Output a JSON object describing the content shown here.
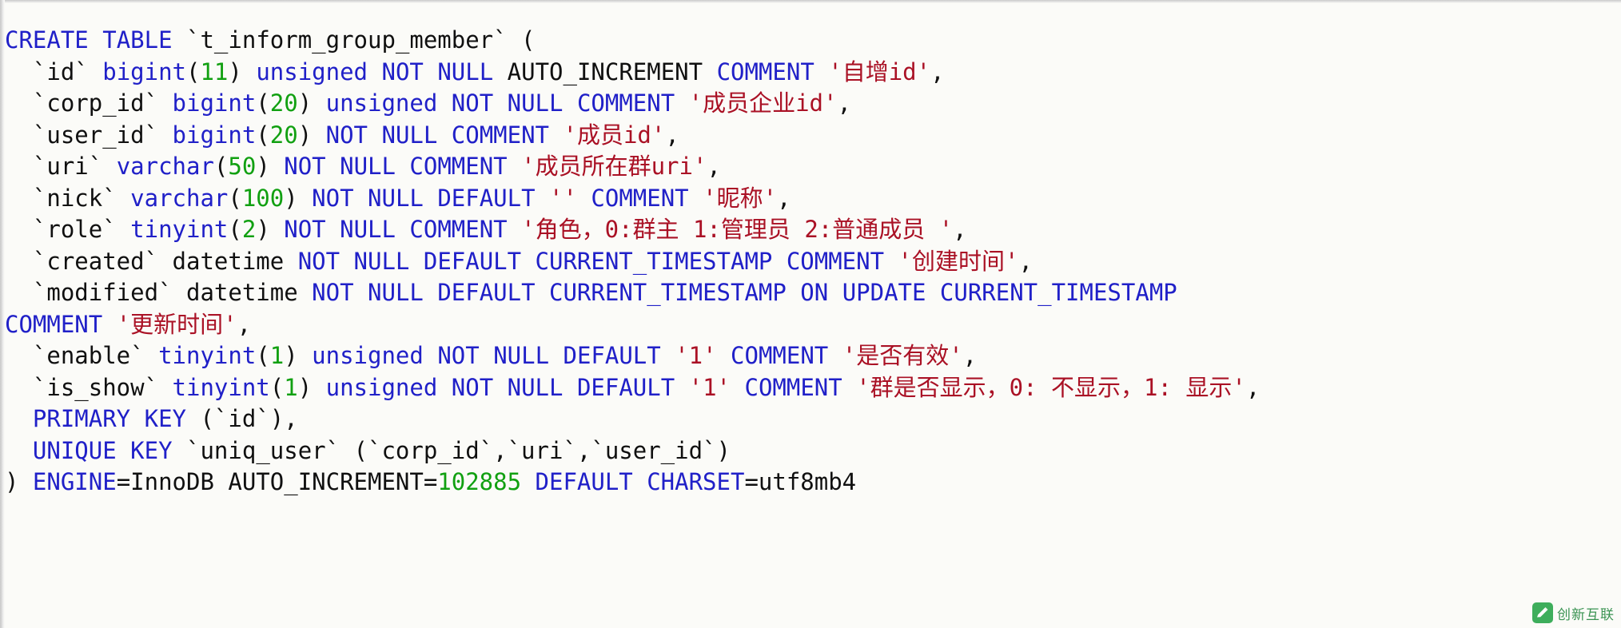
{
  "document": {
    "kind": "sql-create-table",
    "table_name": "t_inform_group_member",
    "engine": "InnoDB",
    "auto_increment": "102885",
    "charset": "utf8mb4",
    "background_color": "#fbfbf8",
    "colors": {
      "keyword": "#2020c8",
      "type": "#2020c8",
      "number": "#11a011",
      "string": "#aa1125",
      "identifier": "#101010"
    }
  },
  "code": {
    "line1": "CREATE TABLE `t_inform_group_member` (",
    "line2": "  `id` bigint(11) unsigned NOT NULL AUTO_INCREMENT COMMENT '自增id',",
    "line3": "  `corp_id` bigint(20) unsigned NOT NULL COMMENT '成员企业id',",
    "line4": "  `user_id` bigint(20) NOT NULL COMMENT '成员id',",
    "line5": "  `uri` varchar(50) NOT NULL COMMENT '成员所在群uri',",
    "line6": "  `nick` varchar(100) NOT NULL DEFAULT '' COMMENT '昵称',",
    "line7": "  `role` tinyint(2) NOT NULL COMMENT '角色，0:群主 1:管理员 2:普通成员 ',",
    "line8": "  `created` datetime NOT NULL DEFAULT CURRENT_TIMESTAMP COMMENT '创建时间',",
    "line9": "  `modified` datetime NOT NULL DEFAULT CURRENT_TIMESTAMP ON UPDATE CURRENT_TIMESTAMP",
    "line10": "COMMENT '更新时间',",
    "line11": "  `enable` tinyint(1) unsigned NOT NULL DEFAULT '1' COMMENT '是否有效',",
    "line12": "  `is_show` tinyint(1) unsigned NOT NULL DEFAULT '1' COMMENT '群是否显示，0: 不显示，1: 显示',",
    "line13": "  PRIMARY KEY (`id`),",
    "line14": "  UNIQUE KEY `uniq_user` (`corp_id`,`uri`,`user_id`)",
    "line15": ") ENGINE=InnoDB AUTO_INCREMENT=102885 DEFAULT CHARSET=utf8mb4"
  },
  "tokens": {
    "l1": [
      {
        "t": "CREATE",
        "c": "kw"
      },
      {
        "t": " ",
        "c": "pl"
      },
      {
        "t": "TABLE",
        "c": "kw"
      },
      {
        "t": " ",
        "c": "pl"
      },
      {
        "t": "`t_inform_group_member`",
        "c": "id"
      },
      {
        "t": " (",
        "c": "id"
      }
    ],
    "l2": [
      {
        "t": "  ",
        "c": "pl"
      },
      {
        "t": "`id`",
        "c": "id"
      },
      {
        "t": " ",
        "c": "pl"
      },
      {
        "t": "bigint",
        "c": "typ"
      },
      {
        "t": "(",
        "c": "id"
      },
      {
        "t": "11",
        "c": "num"
      },
      {
        "t": ")",
        "c": "id"
      },
      {
        "t": " ",
        "c": "pl"
      },
      {
        "t": "unsigned",
        "c": "kw"
      },
      {
        "t": " ",
        "c": "pl"
      },
      {
        "t": "NOT",
        "c": "kw"
      },
      {
        "t": " ",
        "c": "pl"
      },
      {
        "t": "NULL",
        "c": "kw"
      },
      {
        "t": " ",
        "c": "pl"
      },
      {
        "t": "AUTO_INCREMENT",
        "c": "id"
      },
      {
        "t": " ",
        "c": "pl"
      },
      {
        "t": "COMMENT",
        "c": "kw"
      },
      {
        "t": " ",
        "c": "pl"
      },
      {
        "t": "'自增id'",
        "c": "str"
      },
      {
        "t": ",",
        "c": "id"
      }
    ],
    "l3": [
      {
        "t": "  ",
        "c": "pl"
      },
      {
        "t": "`corp_id`",
        "c": "id"
      },
      {
        "t": " ",
        "c": "pl"
      },
      {
        "t": "bigint",
        "c": "typ"
      },
      {
        "t": "(",
        "c": "id"
      },
      {
        "t": "20",
        "c": "num"
      },
      {
        "t": ")",
        "c": "id"
      },
      {
        "t": " ",
        "c": "pl"
      },
      {
        "t": "unsigned",
        "c": "kw"
      },
      {
        "t": " ",
        "c": "pl"
      },
      {
        "t": "NOT",
        "c": "kw"
      },
      {
        "t": " ",
        "c": "pl"
      },
      {
        "t": "NULL",
        "c": "kw"
      },
      {
        "t": " ",
        "c": "pl"
      },
      {
        "t": "COMMENT",
        "c": "kw"
      },
      {
        "t": " ",
        "c": "pl"
      },
      {
        "t": "'成员企业id'",
        "c": "str"
      },
      {
        "t": ",",
        "c": "id"
      }
    ],
    "l4": [
      {
        "t": "  ",
        "c": "pl"
      },
      {
        "t": "`user_id`",
        "c": "id"
      },
      {
        "t": " ",
        "c": "pl"
      },
      {
        "t": "bigint",
        "c": "typ"
      },
      {
        "t": "(",
        "c": "id"
      },
      {
        "t": "20",
        "c": "num"
      },
      {
        "t": ")",
        "c": "id"
      },
      {
        "t": " ",
        "c": "pl"
      },
      {
        "t": "NOT",
        "c": "kw"
      },
      {
        "t": " ",
        "c": "pl"
      },
      {
        "t": "NULL",
        "c": "kw"
      },
      {
        "t": " ",
        "c": "pl"
      },
      {
        "t": "COMMENT",
        "c": "kw"
      },
      {
        "t": " ",
        "c": "pl"
      },
      {
        "t": "'成员id'",
        "c": "str"
      },
      {
        "t": ",",
        "c": "id"
      }
    ],
    "l5": [
      {
        "t": "  ",
        "c": "pl"
      },
      {
        "t": "`uri`",
        "c": "id"
      },
      {
        "t": " ",
        "c": "pl"
      },
      {
        "t": "varchar",
        "c": "typ"
      },
      {
        "t": "(",
        "c": "id"
      },
      {
        "t": "50",
        "c": "num"
      },
      {
        "t": ")",
        "c": "id"
      },
      {
        "t": " ",
        "c": "pl"
      },
      {
        "t": "NOT",
        "c": "kw"
      },
      {
        "t": " ",
        "c": "pl"
      },
      {
        "t": "NULL",
        "c": "kw"
      },
      {
        "t": " ",
        "c": "pl"
      },
      {
        "t": "COMMENT",
        "c": "kw"
      },
      {
        "t": " ",
        "c": "pl"
      },
      {
        "t": "'成员所在群uri'",
        "c": "str"
      },
      {
        "t": ",",
        "c": "id"
      }
    ],
    "l6": [
      {
        "t": "  ",
        "c": "pl"
      },
      {
        "t": "`nick`",
        "c": "id"
      },
      {
        "t": " ",
        "c": "pl"
      },
      {
        "t": "varchar",
        "c": "typ"
      },
      {
        "t": "(",
        "c": "id"
      },
      {
        "t": "100",
        "c": "num"
      },
      {
        "t": ")",
        "c": "id"
      },
      {
        "t": " ",
        "c": "pl"
      },
      {
        "t": "NOT",
        "c": "kw"
      },
      {
        "t": " ",
        "c": "pl"
      },
      {
        "t": "NULL",
        "c": "kw"
      },
      {
        "t": " ",
        "c": "pl"
      },
      {
        "t": "DEFAULT",
        "c": "kw"
      },
      {
        "t": " ",
        "c": "pl"
      },
      {
        "t": "''",
        "c": "str"
      },
      {
        "t": " ",
        "c": "pl"
      },
      {
        "t": "COMMENT",
        "c": "kw"
      },
      {
        "t": " ",
        "c": "pl"
      },
      {
        "t": "'昵称'",
        "c": "str"
      },
      {
        "t": ",",
        "c": "id"
      }
    ],
    "l7": [
      {
        "t": "  ",
        "c": "pl"
      },
      {
        "t": "`role`",
        "c": "id"
      },
      {
        "t": " ",
        "c": "pl"
      },
      {
        "t": "tinyint",
        "c": "typ"
      },
      {
        "t": "(",
        "c": "id"
      },
      {
        "t": "2",
        "c": "num"
      },
      {
        "t": ")",
        "c": "id"
      },
      {
        "t": " ",
        "c": "pl"
      },
      {
        "t": "NOT",
        "c": "kw"
      },
      {
        "t": " ",
        "c": "pl"
      },
      {
        "t": "NULL",
        "c": "kw"
      },
      {
        "t": " ",
        "c": "pl"
      },
      {
        "t": "COMMENT",
        "c": "kw"
      },
      {
        "t": " ",
        "c": "pl"
      },
      {
        "t": "'角色，0:群主 1:管理员 2:普通成员 '",
        "c": "str"
      },
      {
        "t": ",",
        "c": "id"
      }
    ],
    "l8": [
      {
        "t": "  ",
        "c": "pl"
      },
      {
        "t": "`created`",
        "c": "id"
      },
      {
        "t": " ",
        "c": "pl"
      },
      {
        "t": "datetime",
        "c": "id"
      },
      {
        "t": " ",
        "c": "pl"
      },
      {
        "t": "NOT",
        "c": "kw"
      },
      {
        "t": " ",
        "c": "pl"
      },
      {
        "t": "NULL",
        "c": "kw"
      },
      {
        "t": " ",
        "c": "pl"
      },
      {
        "t": "DEFAULT",
        "c": "kw"
      },
      {
        "t": " ",
        "c": "pl"
      },
      {
        "t": "CURRENT_TIMESTAMP",
        "c": "kw"
      },
      {
        "t": " ",
        "c": "pl"
      },
      {
        "t": "COMMENT",
        "c": "kw"
      },
      {
        "t": " ",
        "c": "pl"
      },
      {
        "t": "'创建时间'",
        "c": "str"
      },
      {
        "t": ",",
        "c": "id"
      }
    ],
    "l9": [
      {
        "t": "  ",
        "c": "pl"
      },
      {
        "t": "`modified`",
        "c": "id"
      },
      {
        "t": " ",
        "c": "pl"
      },
      {
        "t": "datetime",
        "c": "id"
      },
      {
        "t": " ",
        "c": "pl"
      },
      {
        "t": "NOT",
        "c": "kw"
      },
      {
        "t": " ",
        "c": "pl"
      },
      {
        "t": "NULL",
        "c": "kw"
      },
      {
        "t": " ",
        "c": "pl"
      },
      {
        "t": "DEFAULT",
        "c": "kw"
      },
      {
        "t": " ",
        "c": "pl"
      },
      {
        "t": "CURRENT_TIMESTAMP",
        "c": "kw"
      },
      {
        "t": " ",
        "c": "pl"
      },
      {
        "t": "ON",
        "c": "kw"
      },
      {
        "t": " ",
        "c": "pl"
      },
      {
        "t": "UPDATE",
        "c": "kw"
      },
      {
        "t": " ",
        "c": "pl"
      },
      {
        "t": "CURRENT_TIMESTAMP",
        "c": "kw"
      }
    ],
    "l10": [
      {
        "t": "COMMENT",
        "c": "kw"
      },
      {
        "t": " ",
        "c": "pl"
      },
      {
        "t": "'更新时间'",
        "c": "str"
      },
      {
        "t": ",",
        "c": "id"
      }
    ],
    "l11": [
      {
        "t": "  ",
        "c": "pl"
      },
      {
        "t": "`enable`",
        "c": "id"
      },
      {
        "t": " ",
        "c": "pl"
      },
      {
        "t": "tinyint",
        "c": "typ"
      },
      {
        "t": "(",
        "c": "id"
      },
      {
        "t": "1",
        "c": "num"
      },
      {
        "t": ")",
        "c": "id"
      },
      {
        "t": " ",
        "c": "pl"
      },
      {
        "t": "unsigned",
        "c": "kw"
      },
      {
        "t": " ",
        "c": "pl"
      },
      {
        "t": "NOT",
        "c": "kw"
      },
      {
        "t": " ",
        "c": "pl"
      },
      {
        "t": "NULL",
        "c": "kw"
      },
      {
        "t": " ",
        "c": "pl"
      },
      {
        "t": "DEFAULT",
        "c": "kw"
      },
      {
        "t": " ",
        "c": "pl"
      },
      {
        "t": "'1'",
        "c": "str"
      },
      {
        "t": " ",
        "c": "pl"
      },
      {
        "t": "COMMENT",
        "c": "kw"
      },
      {
        "t": " ",
        "c": "pl"
      },
      {
        "t": "'是否有效'",
        "c": "str"
      },
      {
        "t": ",",
        "c": "id"
      }
    ],
    "l12": [
      {
        "t": "  ",
        "c": "pl"
      },
      {
        "t": "`is_show`",
        "c": "id"
      },
      {
        "t": " ",
        "c": "pl"
      },
      {
        "t": "tinyint",
        "c": "typ"
      },
      {
        "t": "(",
        "c": "id"
      },
      {
        "t": "1",
        "c": "num"
      },
      {
        "t": ")",
        "c": "id"
      },
      {
        "t": " ",
        "c": "pl"
      },
      {
        "t": "unsigned",
        "c": "kw"
      },
      {
        "t": " ",
        "c": "pl"
      },
      {
        "t": "NOT",
        "c": "kw"
      },
      {
        "t": " ",
        "c": "pl"
      },
      {
        "t": "NULL",
        "c": "kw"
      },
      {
        "t": " ",
        "c": "pl"
      },
      {
        "t": "DEFAULT",
        "c": "kw"
      },
      {
        "t": " ",
        "c": "pl"
      },
      {
        "t": "'1'",
        "c": "str"
      },
      {
        "t": " ",
        "c": "pl"
      },
      {
        "t": "COMMENT",
        "c": "kw"
      },
      {
        "t": " ",
        "c": "pl"
      },
      {
        "t": "'群是否显示，0: 不显示，1: 显示'",
        "c": "str"
      },
      {
        "t": ",",
        "c": "id"
      }
    ],
    "l13": [
      {
        "t": "  ",
        "c": "pl"
      },
      {
        "t": "PRIMARY",
        "c": "kw"
      },
      {
        "t": " ",
        "c": "pl"
      },
      {
        "t": "KEY",
        "c": "kw"
      },
      {
        "t": " ",
        "c": "pl"
      },
      {
        "t": "(`id`),",
        "c": "id"
      }
    ],
    "l14": [
      {
        "t": "  ",
        "c": "pl"
      },
      {
        "t": "UNIQUE",
        "c": "kw"
      },
      {
        "t": " ",
        "c": "pl"
      },
      {
        "t": "KEY",
        "c": "kw"
      },
      {
        "t": " ",
        "c": "pl"
      },
      {
        "t": "`uniq_user`",
        "c": "id"
      },
      {
        "t": " ",
        "c": "pl"
      },
      {
        "t": "(`corp_id`,`uri`,`user_id`)",
        "c": "id"
      }
    ],
    "l15": [
      {
        "t": ") ",
        "c": "id"
      },
      {
        "t": "ENGINE",
        "c": "kw"
      },
      {
        "t": "=",
        "c": "id"
      },
      {
        "t": "InnoDB",
        "c": "id"
      },
      {
        "t": " ",
        "c": "pl"
      },
      {
        "t": "AUTO_INCREMENT",
        "c": "id"
      },
      {
        "t": "=",
        "c": "id"
      },
      {
        "t": "102885",
        "c": "num"
      },
      {
        "t": " ",
        "c": "pl"
      },
      {
        "t": "DEFAULT",
        "c": "kw"
      },
      {
        "t": " ",
        "c": "pl"
      },
      {
        "t": "CHARSET",
        "c": "kw"
      },
      {
        "t": "=",
        "c": "id"
      },
      {
        "t": "utf8mb4",
        "c": "id"
      }
    ]
  },
  "watermark": {
    "text": "创新互联",
    "icon": "pencil-icon",
    "color": "#2a8b45"
  }
}
